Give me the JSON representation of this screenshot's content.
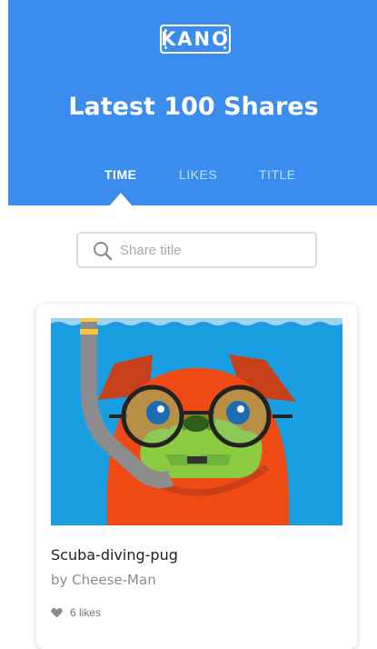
{
  "header": {
    "logo_text": "KANO",
    "title": "Latest 100 Shares",
    "tabs": [
      {
        "label": "TIME",
        "active": true
      },
      {
        "label": "LIKES",
        "active": false
      },
      {
        "label": "TITLE",
        "active": false
      }
    ]
  },
  "search": {
    "placeholder": "Share title",
    "value": "",
    "icon": "search-icon"
  },
  "shares": [
    {
      "title": "Scuba-diving-pug",
      "author": "by Cheese-Man",
      "likes": "6 likes",
      "like_icon": "heart-icon"
    }
  ],
  "colors": {
    "header_blue": "#3b8cef",
    "water_blue": "#1a9ee2",
    "pug_orange": "#f04a14",
    "ear_red": "#c8401a",
    "face_green": "#8ccb41",
    "snorkel_gray": "#8c8c8c",
    "snorkel_yellow": "#f6c543"
  }
}
